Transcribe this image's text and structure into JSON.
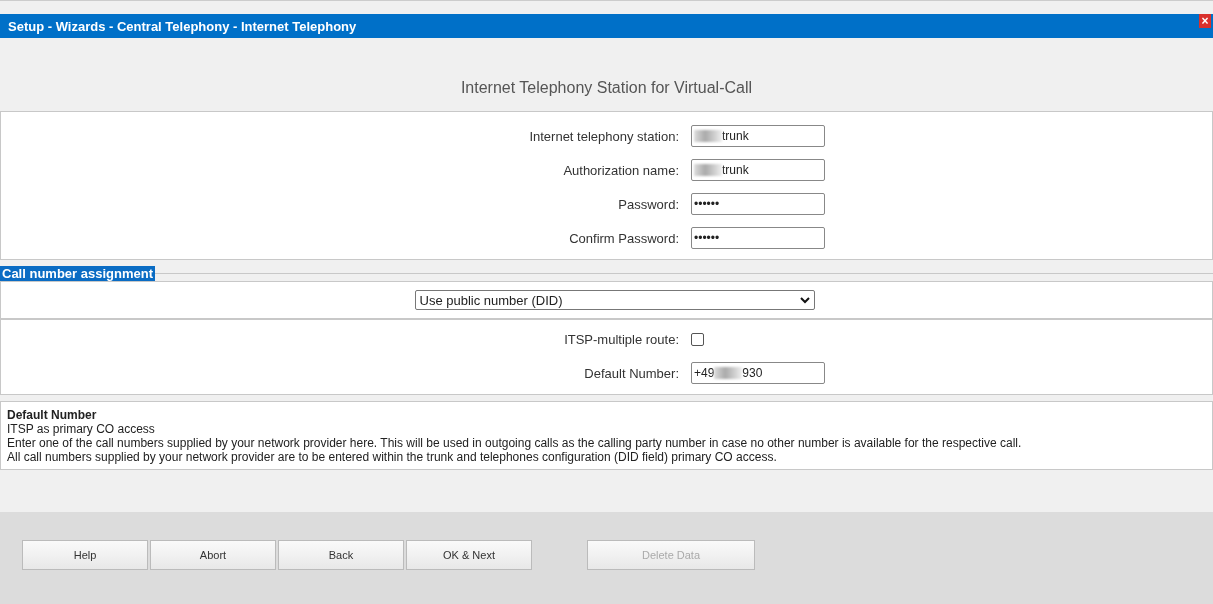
{
  "window": {
    "title": "Setup - Wizards - Central Telephony - Internet Telephony",
    "close": "×"
  },
  "heading": "Internet Telephony Station for Virtual-Call",
  "credentials": [
    {
      "label": "Internet telephony station:",
      "kind": "text",
      "value_after": "trunk",
      "redacted": true
    },
    {
      "label": "Authorization name:",
      "kind": "text",
      "value_after": "trunk",
      "redacted": true
    },
    {
      "label": "Password:",
      "kind": "text",
      "value_before": "••••••",
      "redacted": false
    },
    {
      "label": "Confirm Password:",
      "kind": "text",
      "value_before": "••••••",
      "redacted": false
    }
  ],
  "section": {
    "title": "Call number assignment",
    "select": "Use public number (DID)"
  },
  "routing": [
    {
      "label": "ITSP-multiple route:",
      "kind": "checkbox",
      "checked": false
    },
    {
      "label": "Default Number:",
      "kind": "text",
      "value_before": "+49",
      "value_after": "930",
      "redacted": true
    }
  ],
  "help": {
    "title": "Default Number",
    "lines": [
      "ITSP as primary CO access",
      "Enter one of the call numbers supplied by your network provider here. This will be used in outgoing calls as the calling party number in case no other number is available for the respective call.",
      "All call numbers supplied by your network provider are to be entered within the trunk and telephones configuration (DID field) primary CO access."
    ]
  },
  "buttons": [
    {
      "label": "Help",
      "disabled": false
    },
    {
      "label": "Abort",
      "disabled": false
    },
    {
      "label": "Back",
      "disabled": false
    },
    {
      "label": "OK & Next",
      "disabled": false
    },
    {
      "label": "Delete Data",
      "disabled": true
    }
  ]
}
